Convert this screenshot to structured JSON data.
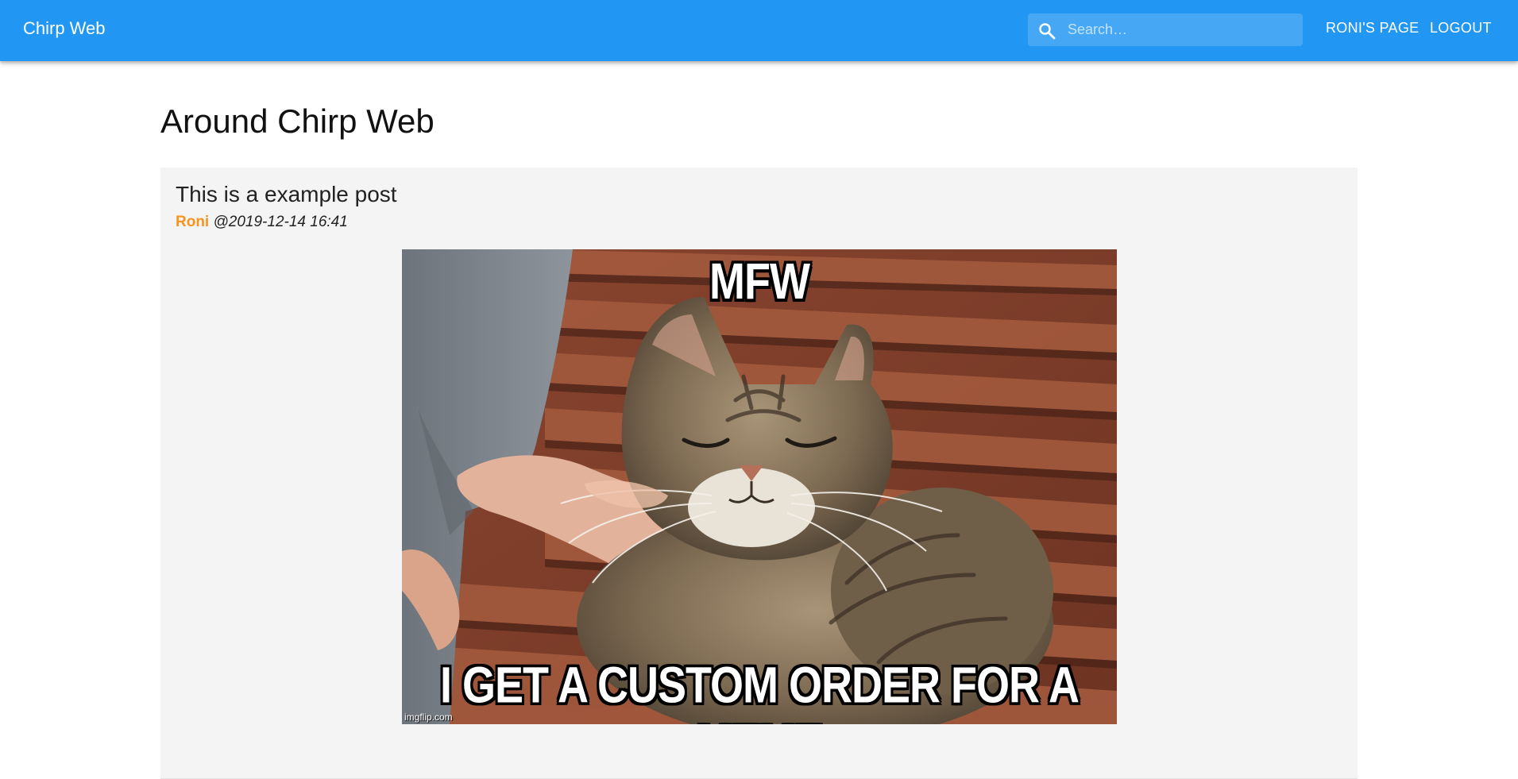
{
  "header": {
    "brand": "Chirp Web",
    "search": {
      "placeholder": "Search…",
      "value": ""
    },
    "nav": {
      "profile_label": "RONI'S PAGE",
      "logout_label": "LOGOUT"
    },
    "colors": {
      "appbar": "#2196f3"
    }
  },
  "main": {
    "title": "Around Chirp Web",
    "posts": [
      {
        "title": "This is a example post",
        "author": "Roni",
        "timestamp": "@2019-12-14 16:41",
        "image": {
          "caption_top": "MFW",
          "caption_bottom": "I GET A CUSTOM ORDER FOR A MEME",
          "watermark": "imgflip.com"
        }
      }
    ]
  },
  "colors": {
    "author": "#f7931e",
    "post_bg": "#f4f4f4"
  }
}
